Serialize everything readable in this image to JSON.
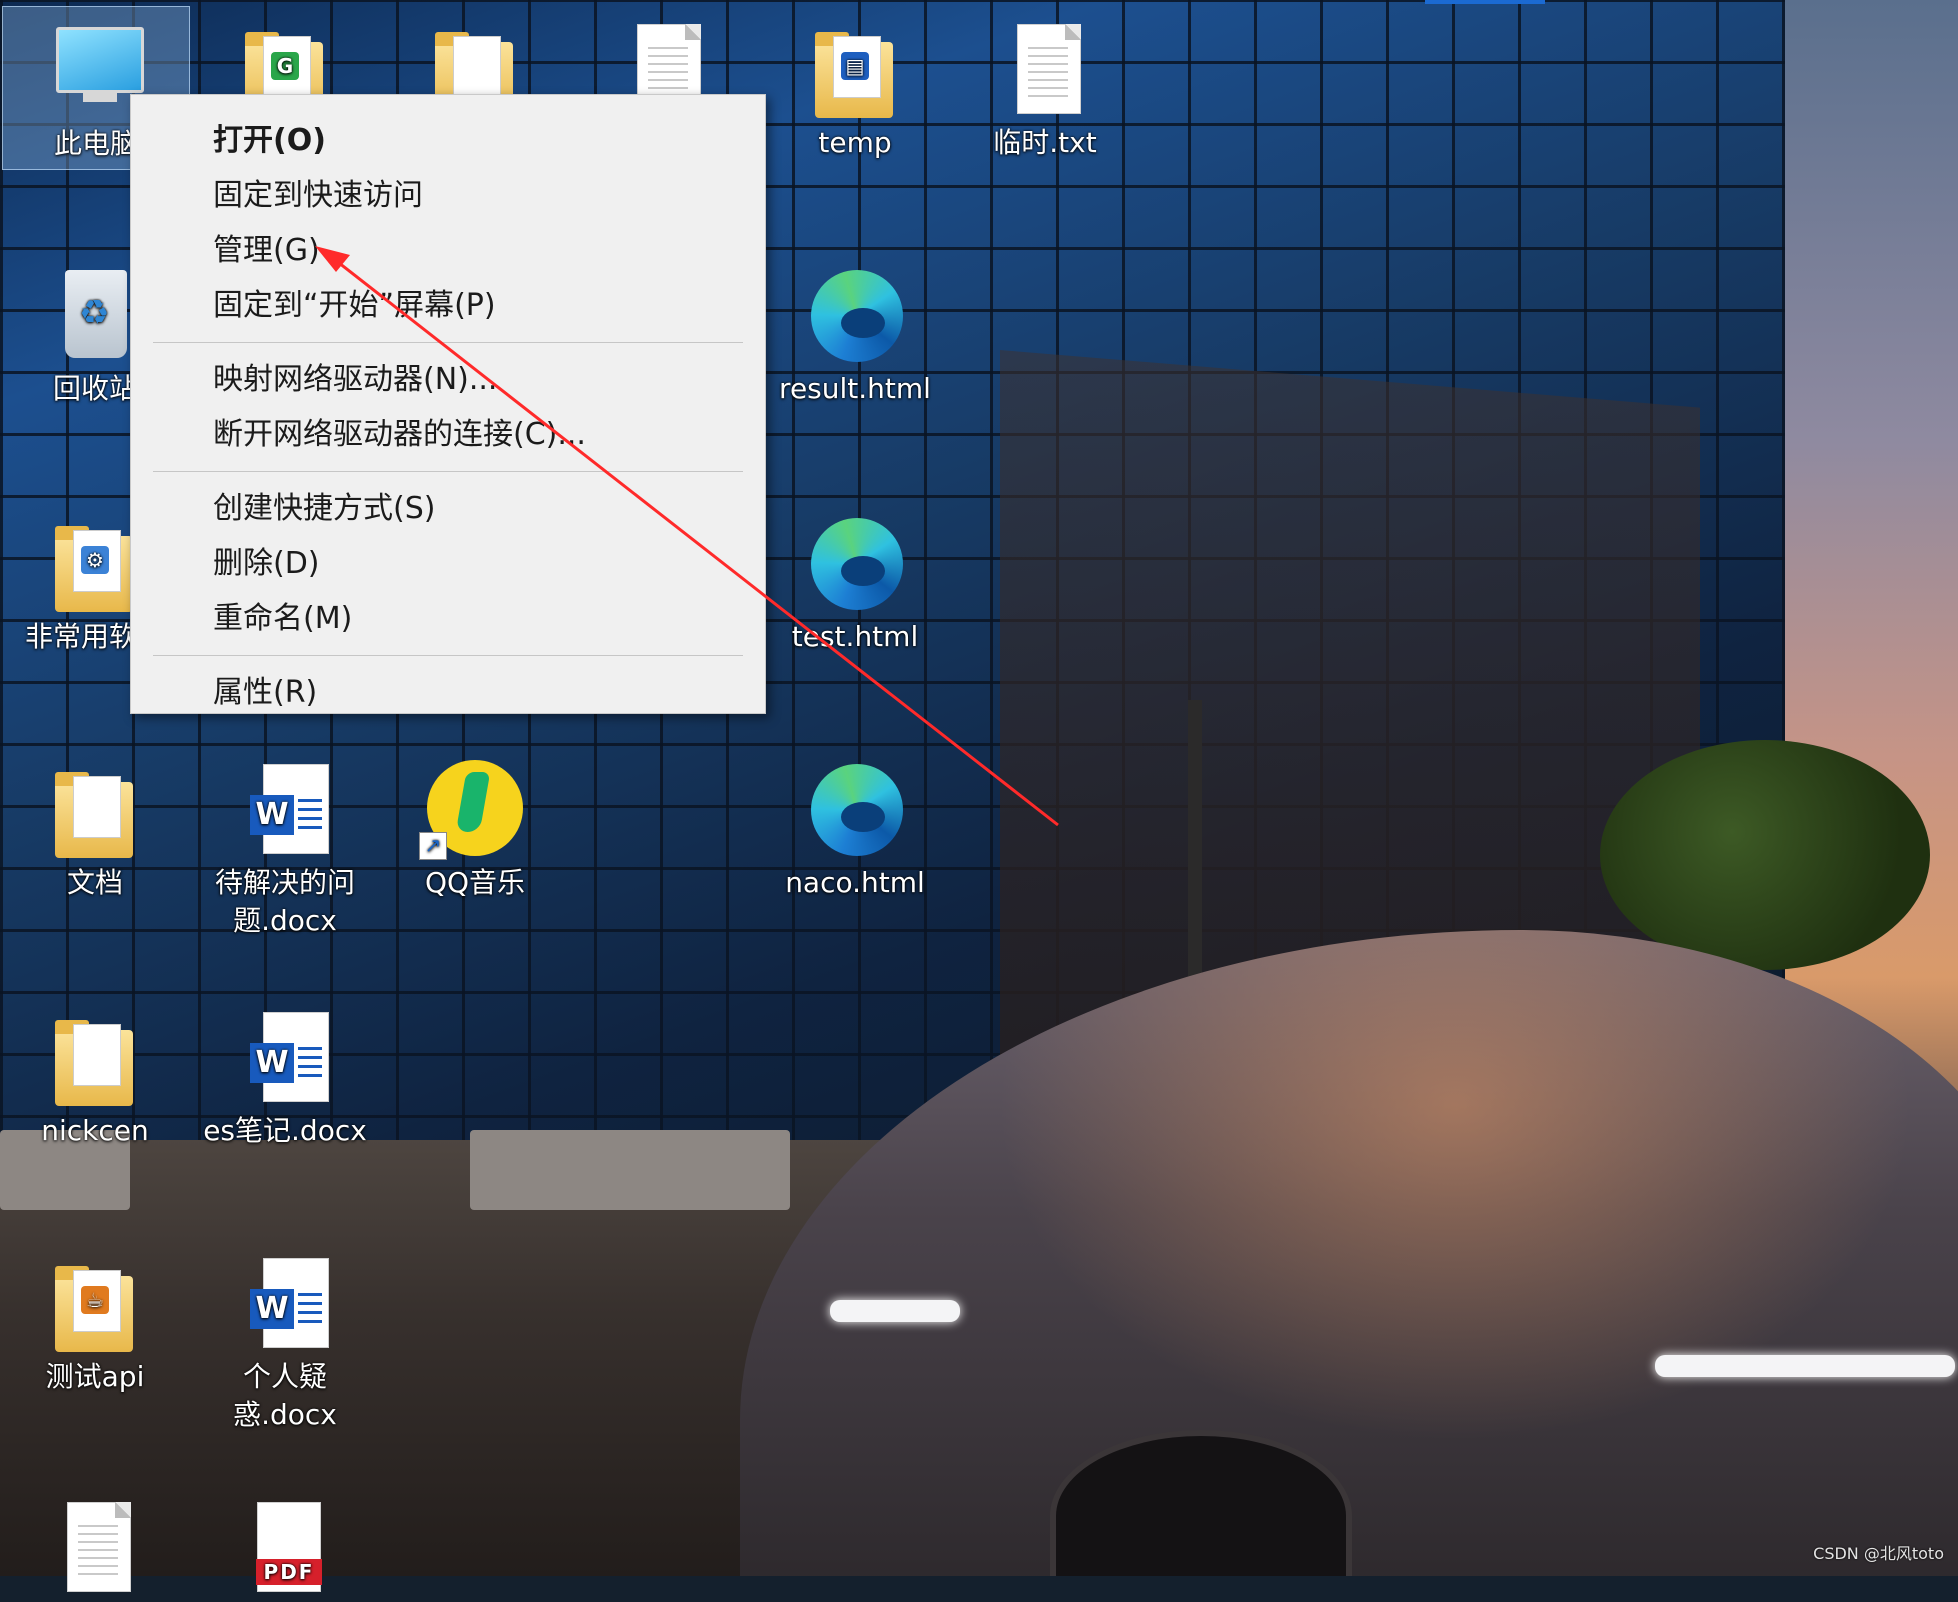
{
  "desktop": {
    "icons": [
      {
        "label": "此电脑",
        "icon": "this-pc-icon"
      },
      {
        "label": "",
        "icon": "folder-icon"
      },
      {
        "label": "",
        "icon": "folder-icon"
      },
      {
        "label": "",
        "icon": "text-file-icon"
      },
      {
        "label": "temp",
        "icon": "folder-icon"
      },
      {
        "label": "临时.txt",
        "icon": "text-file-icon"
      },
      {
        "label": "回收站",
        "icon": "recycle-bin-icon"
      },
      {
        "label": "result.html",
        "icon": "edge-html-icon"
      },
      {
        "label": "非常用软件",
        "icon": "folder-icon"
      },
      {
        "label": "test.html",
        "icon": "edge-html-icon"
      },
      {
        "label": "文档",
        "icon": "folder-icon"
      },
      {
        "label": "待解决的问题.docx",
        "icon": "word-doc-icon"
      },
      {
        "label": "QQ音乐",
        "icon": "qq-music-icon"
      },
      {
        "label": "naco.html",
        "icon": "edge-html-icon"
      },
      {
        "label": "nickcen",
        "icon": "folder-icon"
      },
      {
        "label": "es笔记.docx",
        "icon": "word-doc-icon"
      },
      {
        "label": "测试api",
        "icon": "folder-icon"
      },
      {
        "label": "个人疑惑.docx",
        "icon": "word-doc-icon"
      },
      {
        "label": "",
        "icon": "text-file-icon"
      },
      {
        "label": "",
        "icon": "pdf-file-icon"
      }
    ]
  },
  "context_menu": {
    "items": [
      {
        "label": "打开(O)"
      },
      {
        "label": "固定到快速访问"
      },
      {
        "label": "管理(G)"
      },
      {
        "label": "固定到“开始”屏幕(P)"
      },
      {
        "label": "映射网络驱动器(N)..."
      },
      {
        "label": "断开网络驱动器的连接(C)..."
      },
      {
        "label": "创建快捷方式(S)"
      },
      {
        "label": "删除(D)"
      },
      {
        "label": "重命名(M)"
      },
      {
        "label": "属性(R)"
      }
    ]
  },
  "icon_badges": {
    "folder_g": "G",
    "word": "W",
    "pdf": "PDF",
    "shortcut": "↗"
  },
  "annotation": {
    "arrow_color": "#ff2a2a"
  },
  "watermark": "CSDN @北风toto"
}
